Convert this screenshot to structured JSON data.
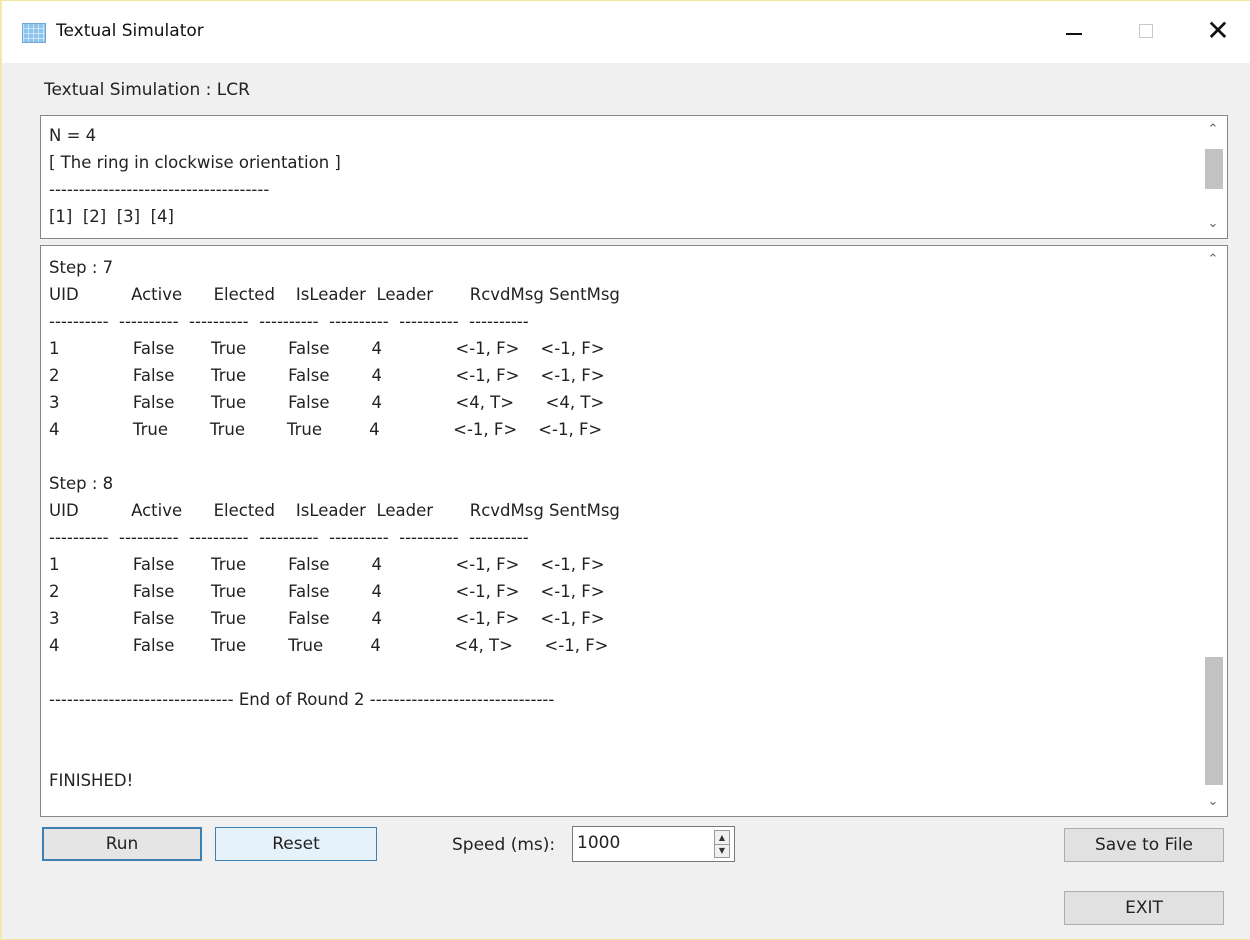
{
  "window": {
    "title": "Textual Simulator"
  },
  "group_label": "Textual Simulation : LCR",
  "top_panel": {
    "text": "N = 4\n[ The ring in clockwise orientation ]\n-------------------------------------\n[1]  [2]  [3]  [4]"
  },
  "main_panel": {
    "text": "Step : 7\nUID          Active      Elected    IsLeader  Leader       RcvdMsg SentMsg\n----------  ----------  ----------  ----------  ----------  ----------  ----------\n1              False       True        False        4              <-1, F>    <-1, F>\n2              False       True        False        4              <-1, F>    <-1, F>\n3              False       True        False        4              <4, T>      <4, T>\n4              True        True        True         4              <-1, F>    <-1, F>\n\nStep : 8\nUID          Active      Elected    IsLeader  Leader       RcvdMsg SentMsg\n----------  ----------  ----------  ----------  ----------  ----------  ----------\n1              False       True        False        4              <-1, F>    <-1, F>\n2              False       True        False        4              <-1, F>    <-1, F>\n3              False       True        False        4              <-1, F>    <-1, F>\n4              False       True        True         4              <4, T>      <-1, F>\n\n------------------------------- End of Round 2 -------------------------------\n\n\nFINISHED!"
  },
  "controls": {
    "run_label": "Run",
    "reset_label": "Reset",
    "speed_label": "Speed (ms):",
    "speed_value": "1000",
    "save_label": "Save to File",
    "exit_label": "EXIT"
  },
  "icons": {
    "app": "grid-app-icon",
    "minimize": "minimize-icon",
    "maximize": "maximize-icon",
    "close": "close-icon",
    "scroll_up": "chevron-up-icon",
    "scroll_down": "chevron-down-icon"
  }
}
